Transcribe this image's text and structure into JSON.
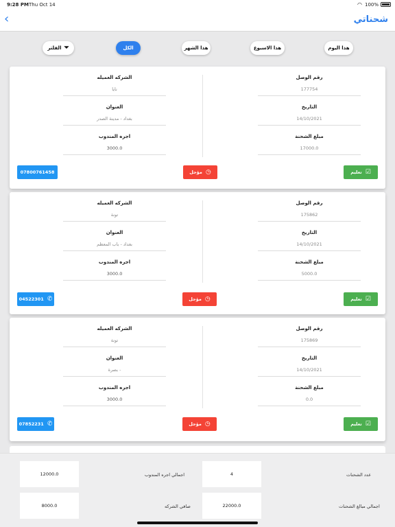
{
  "status": {
    "time": "9:28 PM",
    "date": "Thu Oct 14",
    "battery": "100%"
  },
  "nav": {
    "back_icon": "chevron-left-icon",
    "title": "شحناتي"
  },
  "filters": {
    "today": "هذا اليوم",
    "week": "هذا الاسبوع",
    "month": "هذا الشهر",
    "all": "الكل",
    "filter": "الفلتر",
    "active": "all"
  },
  "labels": {
    "receipt": "رقم الوصل",
    "date": "التاريخ",
    "amount": "مبلغ الشحنة",
    "client": "الشركه العميله",
    "address": "العنوان",
    "delegate_fee": "اجره المندوب",
    "deliver": "تعليم",
    "postpone": "مؤجل"
  },
  "shipments": [
    {
      "receipt": "177754",
      "date": "14/10/2021",
      "amount": "17000.0",
      "client": "نايا",
      "address": "بغداد  -  مدينة الصدر",
      "fee": "3000.0",
      "phone": "07800761458"
    },
    {
      "receipt": "175862",
      "date": "14/10/2021",
      "amount": "5000.0",
      "client": "تونة",
      "address": "بغداد  -  باب المعظم",
      "fee": "3000.0",
      "phone": "04522301"
    },
    {
      "receipt": "175869",
      "date": "14/10/2021",
      "amount": "0.0",
      "client": "تونة",
      "address": "بصرة  -",
      "fee": "3000.0",
      "phone": "07852231"
    }
  ],
  "summary": {
    "count_label": "عدد الشحنات",
    "count": "4",
    "fees_total_label": "اجمالي اجره المندوب",
    "fees_total": "12000.0",
    "amounts_total_label": "اجمالي مبالغ الشحنات",
    "amounts_total": "22000.0",
    "net_label": "صافي الشركه",
    "net": "8000.0"
  }
}
